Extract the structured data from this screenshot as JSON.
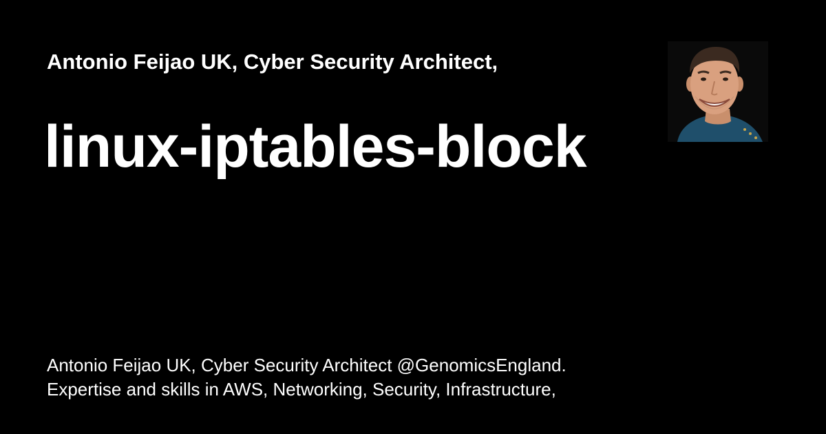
{
  "card": {
    "site_name": "Antonio Feijao UK, Cyber Security Architect,",
    "title": "linux-iptables-block",
    "description_lines": [
      "Antonio Feijao UK, Cyber Security Architect @GenomicsEngland.",
      "Expertise and skills in AWS, Networking, Security, Infrastructure,"
    ],
    "avatar_icon": "author-portrait-icon"
  },
  "colors": {
    "background": "#000000",
    "text": "#ffffff",
    "shirt": "#1f4f6b",
    "skin": "#d9a07f",
    "hair": "#3b2a20"
  }
}
